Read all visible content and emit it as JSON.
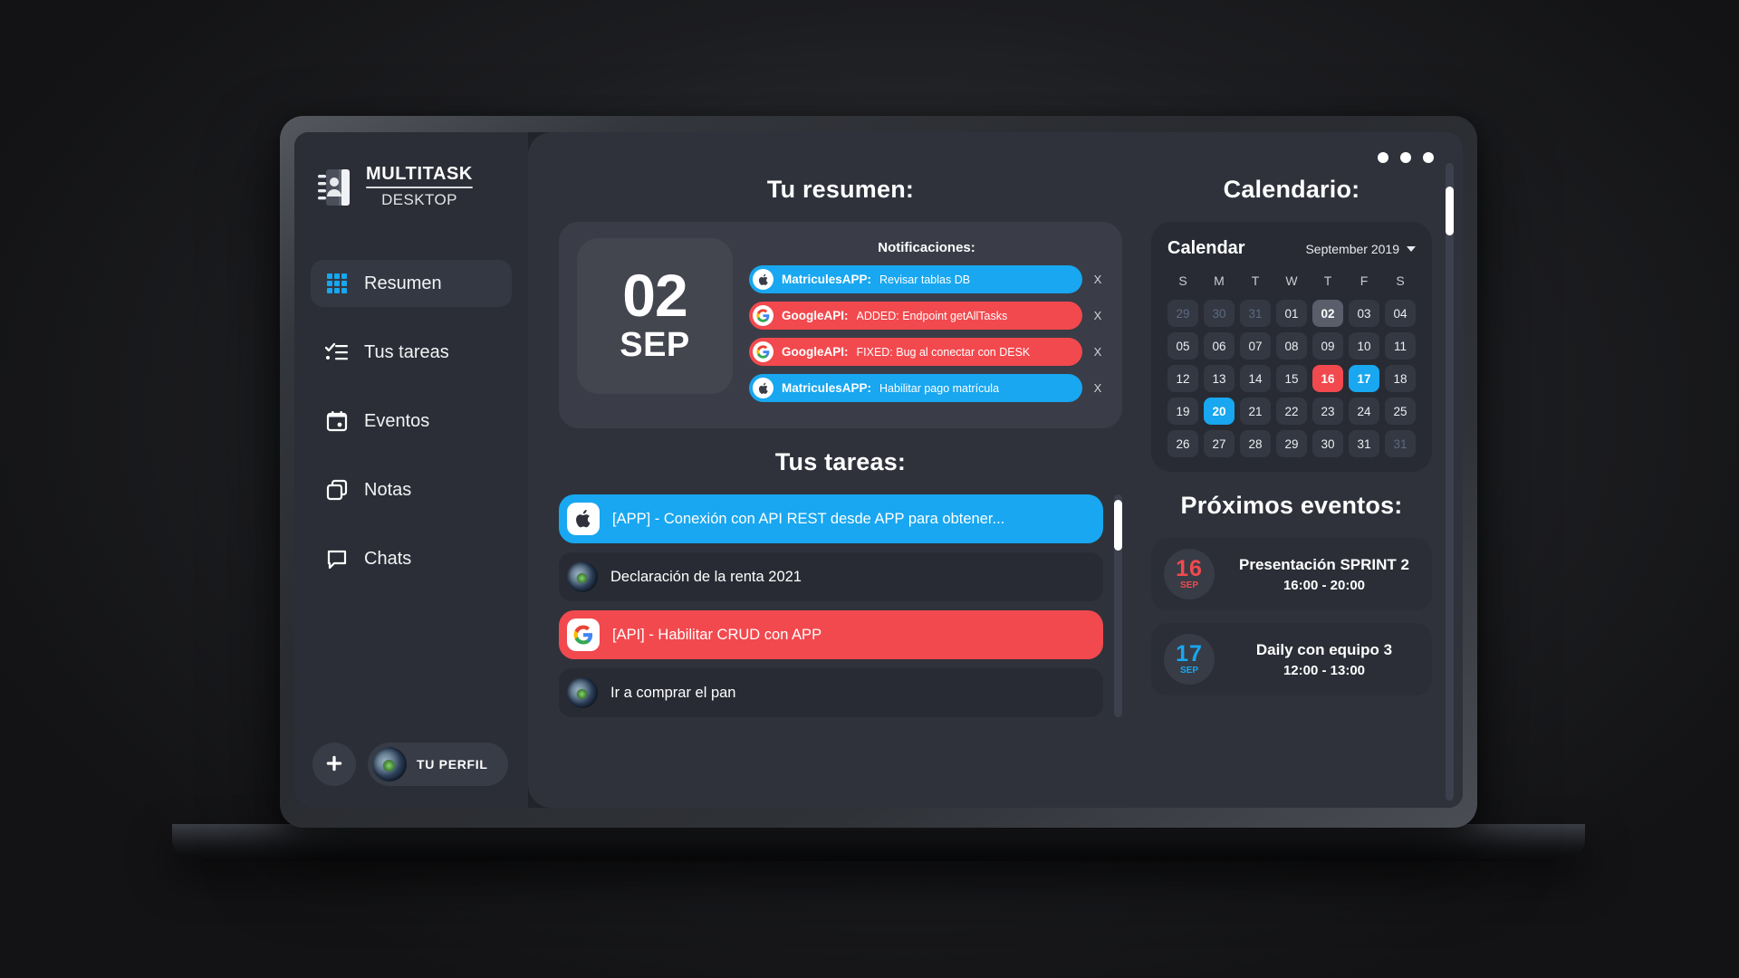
{
  "brand": {
    "icon": "contacts-book-icon",
    "title": "MULTITASK",
    "subtitle": "DESKTOP"
  },
  "sidebar": {
    "items": [
      {
        "label": "Resumen",
        "icon": "grid-icon",
        "active": true
      },
      {
        "label": "Tus tareas",
        "icon": "checklist-icon",
        "active": false
      },
      {
        "label": "Eventos",
        "icon": "calendar-icon",
        "active": false
      },
      {
        "label": "Notas",
        "icon": "copy-icon",
        "active": false
      },
      {
        "label": "Chats",
        "icon": "chat-bubble-icon",
        "active": false
      }
    ],
    "add_button": "+",
    "profile_label": "TU PERFIL",
    "profile_avatar": "avatar-icon"
  },
  "window_controls": {
    "icon": "window-dots-icon",
    "count": 3
  },
  "main": {
    "summary_heading": "Tu resumen:",
    "tasks_heading": "Tus tareas:",
    "calendar_heading": "Calendario:",
    "events_heading": "Próximos eventos:"
  },
  "date_card": {
    "day": "02",
    "month": "SEP"
  },
  "notifications": {
    "title": "Notificaciones:",
    "close_label": "X",
    "items": [
      {
        "app": "MatriculesAPP:",
        "message": "Revisar tablas DB",
        "color": "blue",
        "icon": "apple-icon"
      },
      {
        "app": "GoogleAPI:",
        "message": "ADDED: Endpoint getAllTasks",
        "color": "red",
        "icon": "google-icon"
      },
      {
        "app": "GoogleAPI:",
        "message": "FIXED: Bug al conectar con DESK",
        "color": "red",
        "icon": "google-icon"
      },
      {
        "app": "MatriculesAPP:",
        "message": "Habilitar pago matrícula",
        "color": "blue",
        "icon": "apple-icon"
      }
    ]
  },
  "tasks": [
    {
      "text": "[APP] - Conexión con API REST desde APP para obtener...",
      "color": "blue",
      "icon": "apple-icon"
    },
    {
      "text": "Declaración de la renta 2021",
      "color": "neutral",
      "icon": "avatar-icon"
    },
    {
      "text": "[API] - Habilitar CRUD con APP",
      "color": "red",
      "icon": "google-icon"
    },
    {
      "text": "Ir a comprar el pan",
      "color": "neutral",
      "icon": "avatar-icon"
    }
  ],
  "calendar": {
    "title": "Calendar",
    "month_label": "September 2019",
    "dropdown_icon": "chevron-down-icon",
    "weekdays": [
      "S",
      "M",
      "T",
      "W",
      "T",
      "F",
      "S"
    ],
    "days": [
      {
        "n": "29",
        "state": "muted"
      },
      {
        "n": "30",
        "state": "muted"
      },
      {
        "n": "31",
        "state": "muted"
      },
      {
        "n": "01",
        "state": "normal"
      },
      {
        "n": "02",
        "state": "today"
      },
      {
        "n": "03",
        "state": "normal"
      },
      {
        "n": "04",
        "state": "normal"
      },
      {
        "n": "05",
        "state": "normal"
      },
      {
        "n": "06",
        "state": "normal"
      },
      {
        "n": "07",
        "state": "normal"
      },
      {
        "n": "08",
        "state": "normal"
      },
      {
        "n": "09",
        "state": "normal"
      },
      {
        "n": "10",
        "state": "normal"
      },
      {
        "n": "11",
        "state": "normal"
      },
      {
        "n": "12",
        "state": "normal"
      },
      {
        "n": "13",
        "state": "normal"
      },
      {
        "n": "14",
        "state": "normal"
      },
      {
        "n": "15",
        "state": "normal"
      },
      {
        "n": "16",
        "state": "red"
      },
      {
        "n": "17",
        "state": "blue"
      },
      {
        "n": "18",
        "state": "normal"
      },
      {
        "n": "19",
        "state": "normal"
      },
      {
        "n": "20",
        "state": "blue"
      },
      {
        "n": "21",
        "state": "normal"
      },
      {
        "n": "22",
        "state": "normal"
      },
      {
        "n": "23",
        "state": "normal"
      },
      {
        "n": "24",
        "state": "normal"
      },
      {
        "n": "25",
        "state": "normal"
      },
      {
        "n": "26",
        "state": "normal"
      },
      {
        "n": "27",
        "state": "normal"
      },
      {
        "n": "28",
        "state": "normal"
      },
      {
        "n": "29",
        "state": "normal"
      },
      {
        "n": "30",
        "state": "normal"
      },
      {
        "n": "31",
        "state": "normal"
      },
      {
        "n": "31",
        "state": "muted"
      }
    ]
  },
  "events": [
    {
      "day": "16",
      "month": "SEP",
      "title": "Presentación SPRINT 2",
      "time": "16:00 - 20:00",
      "color": "red"
    },
    {
      "day": "17",
      "month": "SEP",
      "title": "Daily con equipo 3",
      "time": "12:00 - 13:00",
      "color": "blue"
    }
  ],
  "colors": {
    "accent_blue": "#18a7f0",
    "accent_red": "#f2494e",
    "sidebar_bg": "#2b2e36",
    "main_bg": "#2f323b",
    "card_bg": "#282b33"
  }
}
